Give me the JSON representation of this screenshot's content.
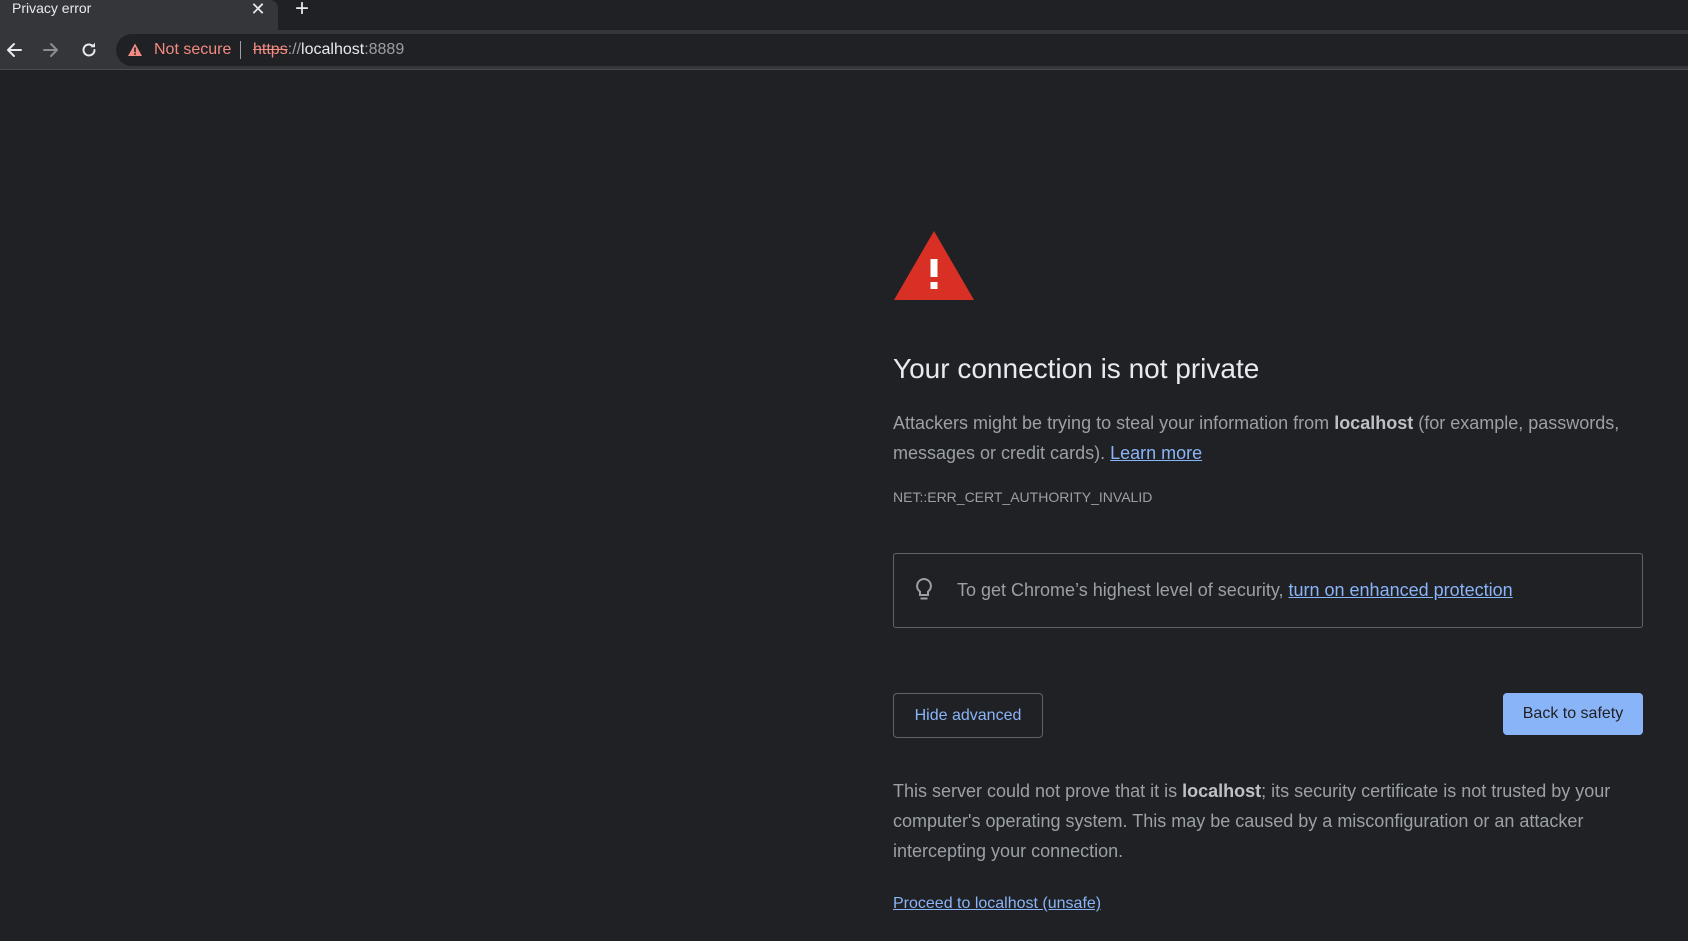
{
  "tab": {
    "title": "Privacy error",
    "close_glyph": "✕",
    "new_tab_glyph": "+"
  },
  "toolbar": {
    "back_icon": "arrow-left-icon",
    "forward_icon": "arrow-right-icon",
    "reload_icon": "reload-icon"
  },
  "omnibox": {
    "security_label": "Not secure",
    "url_scheme": "https",
    "url_separator": "://",
    "url_host": "localhost",
    "url_port": ":8889"
  },
  "page": {
    "heading": "Your connection is not private",
    "message_prefix": "Attackers might be trying to steal your information from ",
    "message_host": "localhost",
    "message_suffix": " (for example, passwords, messages or credit cards). ",
    "learn_more": "Learn more",
    "error_code": "NET::ERR_CERT_AUTHORITY_INVALID",
    "enhanced_prefix": "To get Chrome’s highest level of security, ",
    "enhanced_link": "turn on enhanced protection",
    "hide_advanced": "Hide advanced",
    "back_to_safety": "Back to safety",
    "details_prefix": "This server could not prove that it is ",
    "details_host": "localhost",
    "details_suffix": "; its security certificate is not trusted by your computer's operating system. This may be caused by a misconfiguration or an attacker intercepting your connection.",
    "proceed_link": "Proceed to localhost (unsafe)"
  },
  "colors": {
    "background": "#202124",
    "warning_red": "#d93025",
    "link_blue": "#8ab4f8",
    "not_secure_red": "#f28b82"
  }
}
